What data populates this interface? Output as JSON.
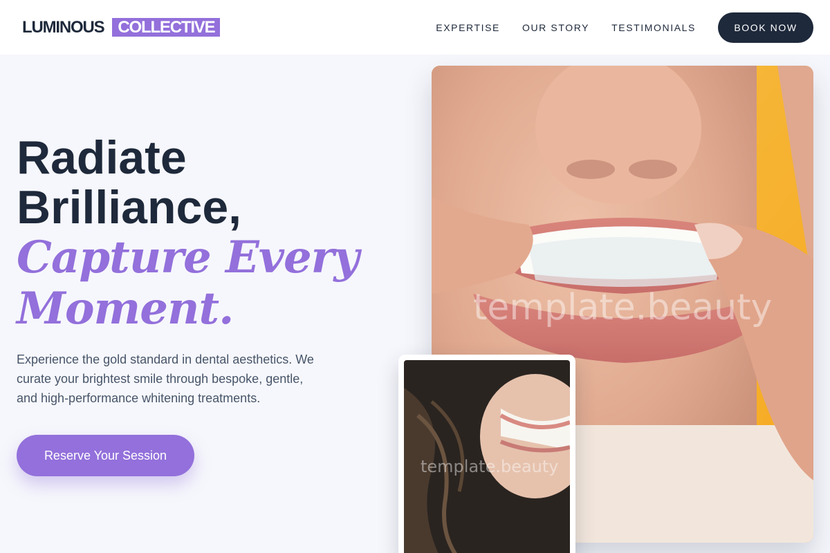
{
  "brand": {
    "part1": "LUMINOUS",
    "part2": "COLLECTIVE",
    "accent": "#9370db",
    "dark": "#1e293b"
  },
  "nav": {
    "items": [
      "EXPERTISE",
      "OUR STORY",
      "TESTIMONIALS"
    ],
    "cta": "BOOK NOW"
  },
  "hero": {
    "line1": "Radiate",
    "line2": "Brilliance,",
    "line3": "Capture Every",
    "line4": "Moment.",
    "description": "Experience the gold standard in dental aesthetics. We curate your brightest smile through bespoke, gentle, and high-performance whitening treatments.",
    "cta": "Reserve Your Session"
  },
  "images": {
    "main": {
      "subject": "woman inserting clear aligner tray",
      "watermark": "template.beauty"
    },
    "small": {
      "subject": "smiling woman with wavy hair",
      "watermark": "template.beauty"
    }
  }
}
